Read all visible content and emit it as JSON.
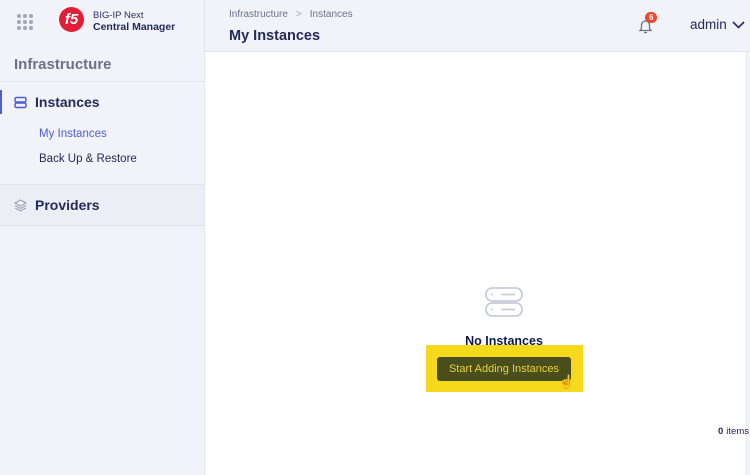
{
  "brand": {
    "logo": "f5",
    "line1": "BIG-IP Next",
    "line2": "Central Manager"
  },
  "sidebar": {
    "section": "Infrastructure",
    "groups": [
      {
        "label": "Instances",
        "icon": "server-icon",
        "items": [
          {
            "label": "My Instances",
            "active": true
          },
          {
            "label": "Back Up & Restore"
          }
        ]
      },
      {
        "label": "Providers",
        "icon": "layers-icon"
      }
    ]
  },
  "header": {
    "breadcrumb": [
      "Infrastructure",
      "Instances"
    ],
    "title": "My Instances",
    "notifications": "6",
    "user": "admin"
  },
  "main": {
    "empty_title": "No Instances",
    "button": "Start Adding Instances",
    "count": "0",
    "count_label": "items"
  },
  "colors": {
    "accent": "#4c5fd5",
    "highlight": "#f5d91d",
    "badge": "#f0452c"
  }
}
